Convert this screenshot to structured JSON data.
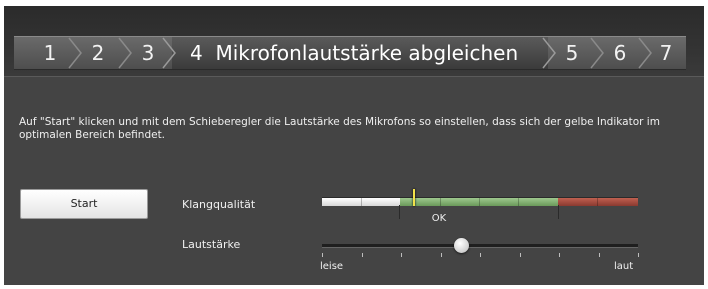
{
  "wizard": {
    "steps": [
      {
        "number": "1"
      },
      {
        "number": "2"
      },
      {
        "number": "3"
      },
      {
        "number": "4",
        "title": "Mikrofonlautstärke abgleichen"
      },
      {
        "number": "5"
      },
      {
        "number": "6"
      },
      {
        "number": "7"
      }
    ],
    "active_step_index": 3
  },
  "instructions": "Auf \"Start\" klicken und mit dem Schieberegler die Lautstärke des Mikrofons so einstellen, dass sich der gelbe Indikator im optimalen Bereich befindet.",
  "start_button": {
    "label": "Start"
  },
  "sound_quality": {
    "label": "Klangqualität",
    "ok_label": "OK",
    "indicator_level": 0.29,
    "zones": [
      {
        "name": "low",
        "color": "#e6e6e6",
        "to": 0.25
      },
      {
        "name": "ok",
        "color": "#86b274",
        "to": 0.75
      },
      {
        "name": "high",
        "color": "#a84a3e",
        "to": 1.0
      }
    ],
    "indicator_color": "#f2e24a"
  },
  "volume": {
    "label": "Lautstärke",
    "min_label": "leise",
    "max_label": "laut",
    "value": 0.44,
    "tick_count": 9
  },
  "colors": {
    "background": "#444444",
    "header_bar": "#2b2b2b",
    "text": "#f0f0f0"
  }
}
